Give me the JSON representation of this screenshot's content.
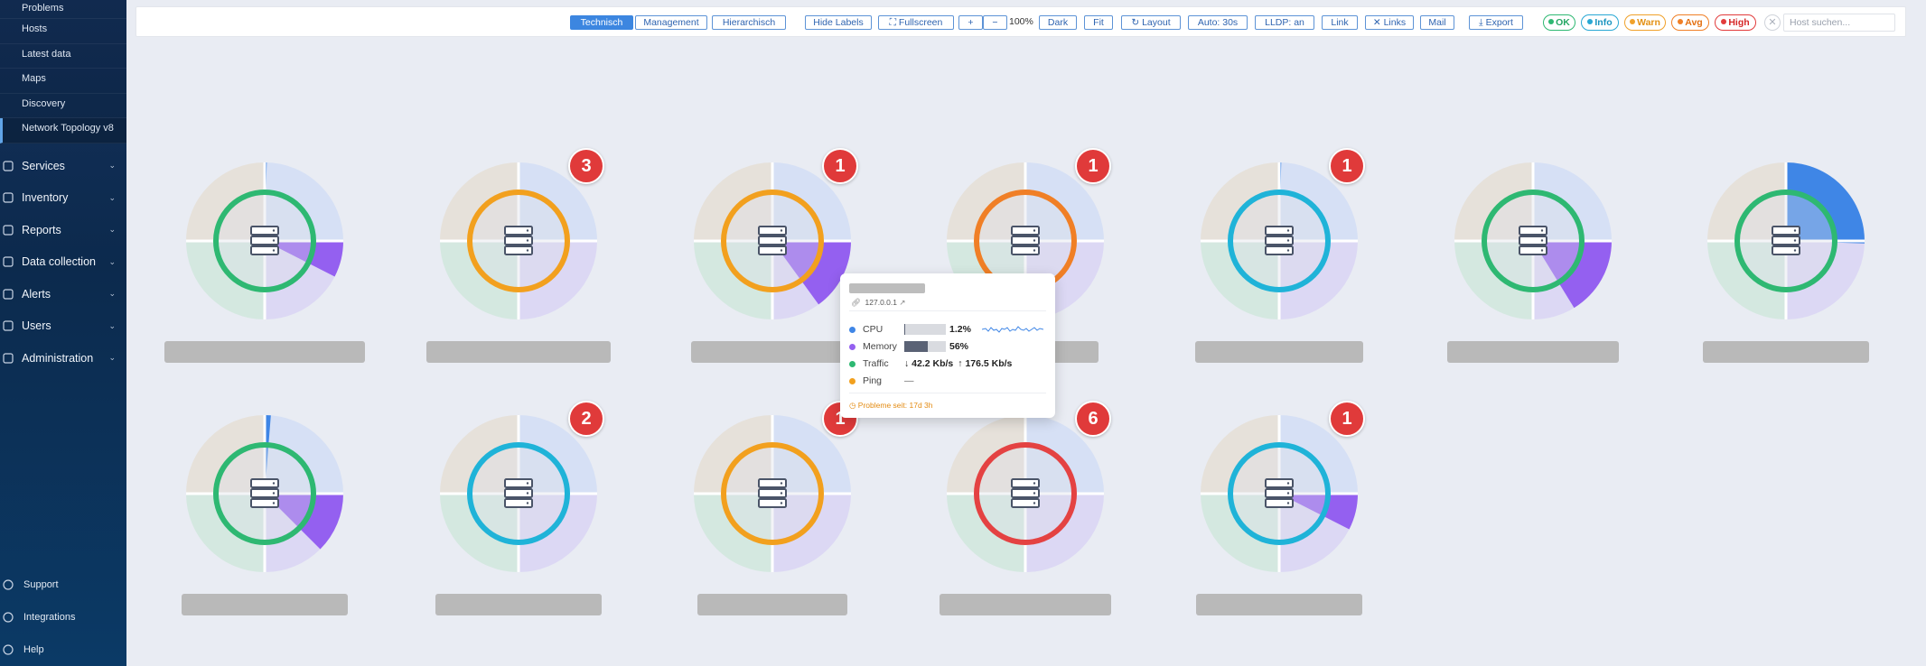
{
  "sidebar": {
    "sub_items": [
      {
        "label": "Problems"
      },
      {
        "label": "Hosts"
      },
      {
        "label": "Latest data"
      },
      {
        "label": "Maps"
      },
      {
        "label": "Discovery"
      },
      {
        "label": "Network Topology v8"
      }
    ],
    "nav_items": [
      {
        "label": "Services",
        "icon": "services-icon"
      },
      {
        "label": "Inventory",
        "icon": "inventory-icon"
      },
      {
        "label": "Reports",
        "icon": "reports-icon"
      },
      {
        "label": "Data collection",
        "icon": "data-collection-icon"
      },
      {
        "label": "Alerts",
        "icon": "alerts-icon"
      },
      {
        "label": "Users",
        "icon": "users-icon"
      },
      {
        "label": "Administration",
        "icon": "administration-icon"
      }
    ],
    "bottom_items": [
      {
        "label": "Support",
        "icon": "support-icon"
      },
      {
        "label": "Integrations",
        "icon": "integrations-icon"
      },
      {
        "label": "Help",
        "icon": "help-icon"
      }
    ]
  },
  "toolbar": {
    "view_tabs": [
      "Technisch",
      "Management",
      "Hierarchisch"
    ],
    "hide_labels": "Hide Labels",
    "fullscreen": "⛶ Fullscreen",
    "zoom_in": "+",
    "zoom_out": "−",
    "zoom_level": "100%",
    "dark": "Dark",
    "fit": "Fit",
    "layout": "↻ Layout",
    "auto": "Auto: 30s",
    "lldp": "LLDP: an",
    "link": "Link",
    "links": "✕ Links",
    "mail": "Mail",
    "export": "⤓ Export",
    "severity": {
      "ok": "OK",
      "info": "Info",
      "warn": "Warn",
      "avg": "Avg",
      "high": "High"
    },
    "clear": "✕",
    "search_placeholder": "Host suchen..."
  },
  "colors": {
    "ok": "#2eb872",
    "info": "#1fb3d8",
    "warn": "#f2a01e",
    "avg": "#f07f26",
    "high": "#e44242",
    "cpu": "#3f86e6",
    "memory": "#9460f0",
    "traffic": "#2eb872",
    "ping": "#f2a01e"
  },
  "nodes": [
    {
      "status": "ok",
      "badge": "",
      "cpu": 0.012,
      "memory": 0.3
    },
    {
      "status": "warn",
      "badge": "3",
      "cpu": 0,
      "memory": 0
    },
    {
      "status": "warn",
      "badge": "1",
      "cpu": 0,
      "memory": 0.6
    },
    {
      "status": "avg",
      "badge": "1",
      "cpu": 0,
      "memory": 0
    },
    {
      "status": "info",
      "badge": "1",
      "cpu": 0.003,
      "memory": 0
    },
    {
      "status": "ok",
      "badge": "",
      "cpu": 0,
      "memory": 0.65
    },
    {
      "status": "ok",
      "badge": "",
      "cpu": 0.85,
      "memory": 0
    },
    {
      "status": "ok",
      "badge": "",
      "cpu": 0.05,
      "memory": 0.5
    },
    {
      "status": "info",
      "badge": "2",
      "cpu": 0,
      "memory": 0
    },
    {
      "status": "warn",
      "badge": "1",
      "cpu": 0,
      "memory": 0
    },
    {
      "status": "high",
      "badge": "6",
      "cpu": 0,
      "memory": 0
    },
    {
      "status": "info",
      "badge": "1",
      "cpu": 0,
      "memory": 0.3
    }
  ],
  "tooltip": {
    "host": "127.0.0.1",
    "link_icon": "link-icon",
    "metrics": [
      {
        "name": "CPU",
        "color": "#3f86e6",
        "value": "1.2%",
        "bar": 0.012
      },
      {
        "name": "Memory",
        "color": "#9460f0",
        "value": "56%",
        "bar": 0.56
      },
      {
        "name": "Traffic",
        "color": "#2eb872",
        "down": "↓ 42.2 Kb/s",
        "up": "↑ 176.5 Kb/s"
      },
      {
        "name": "Ping",
        "color": "#f2a01e",
        "value": "—"
      }
    ],
    "footer_label": "Probleme seit:",
    "footer_value": "17d 3h"
  }
}
